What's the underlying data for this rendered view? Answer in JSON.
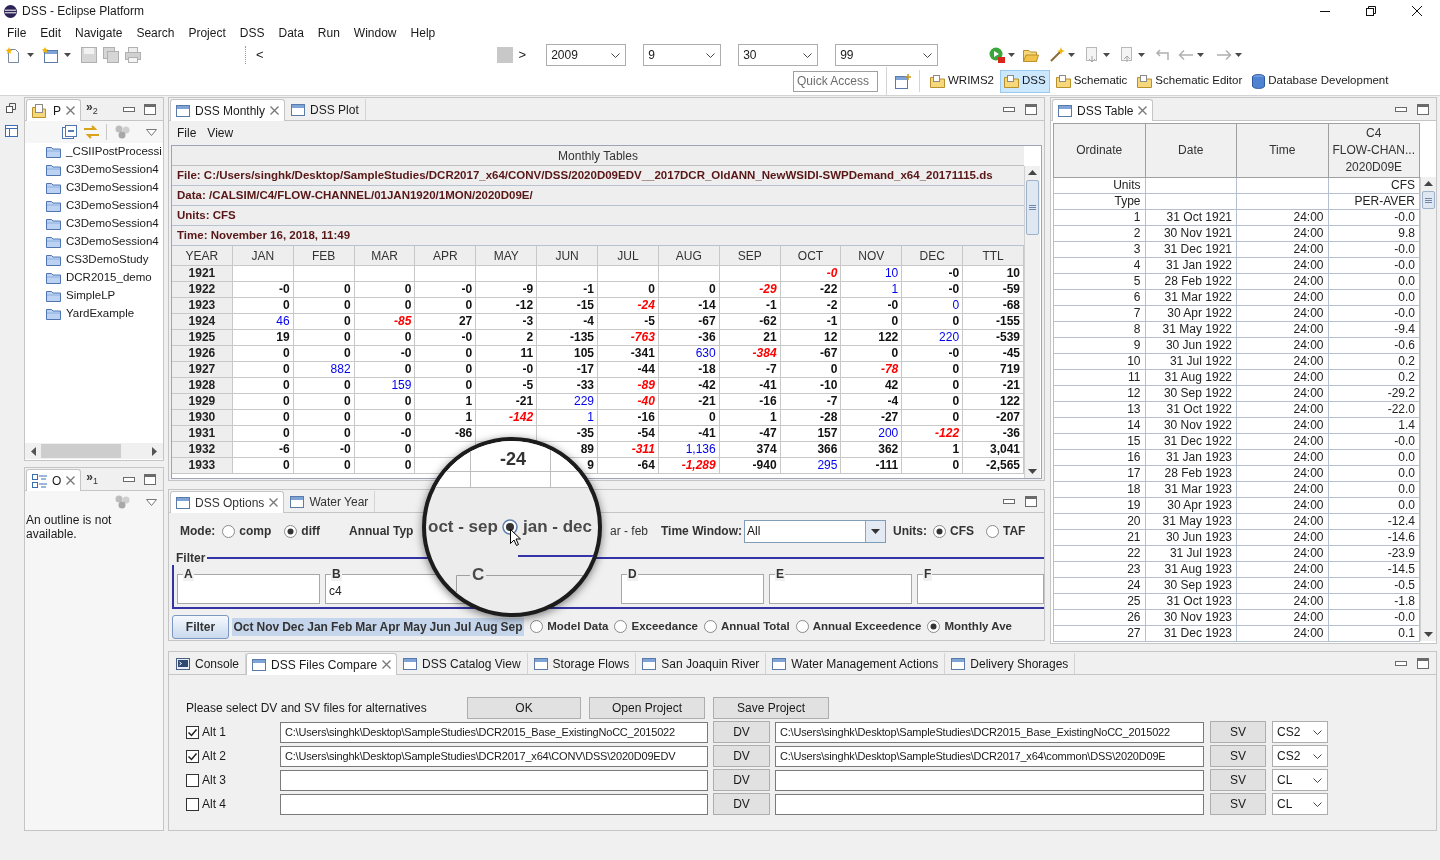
{
  "window": {
    "title": "DSS - Eclipse Platform"
  },
  "menu_bar": [
    "File",
    "Edit",
    "Navigate",
    "Search",
    "Project",
    "DSS",
    "Data",
    "Run",
    "Window",
    "Help"
  ],
  "toolbar": {
    "back": "<",
    "forward": ">",
    "combos": [
      "2009",
      "9",
      "30",
      "99"
    ]
  },
  "quick_access": {
    "placeholder": "Quick Access"
  },
  "perspectives": [
    {
      "label": "WRIMS2",
      "selected": false
    },
    {
      "label": "DSS",
      "selected": true
    },
    {
      "label": "Schematic",
      "selected": false
    },
    {
      "label": "Schematic Editor",
      "selected": false
    },
    {
      "label": "Database Development",
      "selected": false
    }
  ],
  "project_explorer": {
    "tabs": [
      {
        "label": "P",
        "selected": true
      }
    ],
    "overflow": {
      "symbol": "»",
      "count": "2"
    },
    "items": [
      "_CSIIPostProcessi",
      "C3DemoSession4",
      "C3DemoSession4",
      "C3DemoSession4",
      "C3DemoSession4",
      "C3DemoSession4",
      "CS3DemoStudy",
      "DCR2015_demo",
      "SimpleLP",
      "YardExample"
    ]
  },
  "outline": {
    "tabs": [
      {
        "label": "O",
        "selected": true
      }
    ],
    "overflow": {
      "symbol": "»",
      "count": "1"
    },
    "message": "An outline is not available."
  },
  "monthly_view": {
    "tabs": [
      {
        "label": "DSS Monthly",
        "selected": true
      },
      {
        "label": "DSS Plot",
        "selected": false
      }
    ],
    "menu": [
      "File",
      "View"
    ],
    "table": {
      "title": "Monthly Tables",
      "info": [
        "File: C:/Users/singhk/Desktop/SampleStudies/DCR2017_x64/CONV/DSS/2020D09EDV__2017DCR_OldANN_NewWSIDI-SWPDemand_x64_20171115.ds",
        "Data: /CALSIM/C4/FLOW-CHANNEL/01JAN1920/1MON/2020D09E/",
        "Units: CFS",
        "Time: November 16, 2018, 11:49"
      ],
      "columns": [
        "YEAR",
        "JAN",
        "FEB",
        "MAR",
        "APR",
        "MAY",
        "JUN",
        "JUL",
        "AUG",
        "SEP",
        "OCT",
        "NOV",
        "DEC",
        "TTL"
      ],
      "rows": [
        {
          "year": "1921",
          "cells": [
            null,
            null,
            null,
            null,
            null,
            null,
            null,
            null,
            null,
            {
              "text": "-0",
              "kind": "min"
            },
            {
              "text": "10",
              "kind": "max"
            },
            "-0",
            "10"
          ]
        },
        {
          "year": "1922",
          "cells": [
            "-0",
            "0",
            "0",
            "-0",
            "-9",
            "-1",
            "0",
            "0",
            {
              "text": "-29",
              "kind": "min"
            },
            "-22",
            {
              "text": "1",
              "kind": "max"
            },
            "-0",
            "-59"
          ]
        },
        {
          "year": "1923",
          "cells": [
            "0",
            "0",
            "0",
            "0",
            "-12",
            "-15",
            {
              "text": "-24",
              "kind": "min"
            },
            "-14",
            "-1",
            "-2",
            "-0",
            {
              "text": "0",
              "kind": "max"
            },
            "-68"
          ]
        },
        {
          "year": "1924",
          "cells": [
            {
              "text": "46",
              "kind": "max"
            },
            "0",
            {
              "text": "-85",
              "kind": "min"
            },
            "27",
            "-3",
            "-4",
            "-5",
            "-67",
            "-62",
            "-1",
            "0",
            "0",
            "-155"
          ]
        },
        {
          "year": "1925",
          "cells": [
            "19",
            "0",
            "0",
            "-0",
            "2",
            "-135",
            {
              "text": "-763",
              "kind": "min"
            },
            "-36",
            "21",
            "12",
            "122",
            {
              "text": "220",
              "kind": "max"
            },
            "-539"
          ]
        },
        {
          "year": "1926",
          "cells": [
            "0",
            "0",
            "-0",
            "0",
            "11",
            "105",
            "-341",
            {
              "text": "630",
              "kind": "max"
            },
            {
              "text": "-384",
              "kind": "min"
            },
            "-67",
            "0",
            "-0",
            "-45"
          ]
        },
        {
          "year": "1927",
          "cells": [
            "0",
            {
              "text": "882",
              "kind": "max"
            },
            "0",
            "0",
            "-0",
            "-17",
            "-44",
            "-18",
            "-7",
            "0",
            {
              "text": "-78",
              "kind": "min"
            },
            "0",
            "719"
          ]
        },
        {
          "year": "1928",
          "cells": [
            "0",
            "0",
            {
              "text": "159",
              "kind": "max"
            },
            "0",
            "-5",
            "-33",
            {
              "text": "-89",
              "kind": "min"
            },
            "-42",
            "-41",
            "-10",
            "42",
            "0",
            "-21"
          ]
        },
        {
          "year": "1929",
          "cells": [
            "0",
            "0",
            "0",
            "1",
            "-21",
            {
              "text": "229",
              "kind": "max"
            },
            {
              "text": "-40",
              "kind": "min"
            },
            "-21",
            "-16",
            "-7",
            "-4",
            "0",
            "122"
          ]
        },
        {
          "year": "1930",
          "cells": [
            "0",
            "0",
            "0",
            "1",
            {
              "text": "-142",
              "kind": "min"
            },
            {
              "text": "1",
              "kind": "max"
            },
            "-16",
            "0",
            "1",
            "-28",
            "-27",
            "0",
            "-207"
          ]
        },
        {
          "year": "1931",
          "cells": [
            "0",
            "0",
            "-0",
            "-86",
            null,
            "-35",
            "-54",
            "-41",
            "-47",
            "157",
            {
              "text": "200",
              "kind": "max"
            },
            {
              "text": "-122",
              "kind": "min"
            },
            "-36"
          ]
        },
        {
          "year": "1932",
          "cells": [
            "-6",
            "-0",
            "0",
            null,
            null,
            "89",
            {
              "text": "-311",
              "kind": "min"
            },
            {
              "text": "1,136",
              "kind": "max"
            },
            "374",
            "366",
            "362",
            "1",
            "3,041"
          ]
        },
        {
          "year": "1933",
          "cells": [
            "0",
            "0",
            "0",
            null,
            null,
            "9",
            "-64",
            {
              "text": "-1,289",
              "kind": "min"
            },
            "-940",
            {
              "text": "295",
              "kind": "max"
            },
            "-111",
            "0",
            "-2,565"
          ]
        }
      ]
    }
  },
  "options_view": {
    "tabs": [
      {
        "label": "DSS Options",
        "selected": true
      },
      {
        "label": "Water Year",
        "selected": false
      }
    ],
    "mode": {
      "label": "Mode:",
      "options": [
        {
          "label": "comp",
          "selected": false
        },
        {
          "label": "diff",
          "selected": true
        }
      ]
    },
    "annual_type": {
      "label": "Annual Typ",
      "option_fragment": "ar - feb"
    },
    "time_window": {
      "label": "Time Window:",
      "value": "All"
    },
    "units": {
      "label": "Units:",
      "options": [
        {
          "label": "CFS",
          "selected": true
        },
        {
          "label": "TAF",
          "selected": false
        }
      ]
    },
    "filter": {
      "title": "Filter",
      "fields": [
        {
          "label": "A"
        },
        {
          "label": "B",
          "value": "c4"
        },
        {
          "label": "D"
        },
        {
          "label": "E"
        },
        {
          "label": "F"
        }
      ]
    },
    "filter_button": "Filter",
    "months": [
      {
        "label": "Oct",
        "selected": true
      },
      {
        "label": "Nov",
        "selected": true
      },
      {
        "label": "Dec",
        "selected": true
      },
      {
        "label": "Jan",
        "selected": true
      },
      {
        "label": "Feb",
        "selected": true
      },
      {
        "label": "Mar",
        "selected": true
      },
      {
        "label": "Apr",
        "selected": true
      },
      {
        "label": "May",
        "selected": true
      },
      {
        "label": "Jun",
        "selected": true
      },
      {
        "label": "Jul",
        "selected": true
      },
      {
        "label": "Aug",
        "selected": true
      },
      {
        "label": "Sep",
        "selected": true
      }
    ],
    "views": [
      {
        "label": "Model Data",
        "selected": false
      },
      {
        "label": "Exceedance",
        "selected": false
      },
      {
        "label": "Annual Total",
        "selected": false
      },
      {
        "label": "Annual Exceedence",
        "selected": false
      },
      {
        "label": "Monthly Ave",
        "selected": true
      }
    ]
  },
  "magnifier": {
    "cell": "-24",
    "fragment": "oct - sep",
    "option": {
      "label": "jan - dec",
      "selected": true
    },
    "field_label": "C"
  },
  "dss_table_view": {
    "tabs": [
      {
        "label": "DSS Table",
        "selected": true
      }
    ],
    "columns": [
      "Ordinate",
      "Date",
      "Time",
      "C4\nFLOW-CHAN...\n2020D09E"
    ],
    "meta": [
      {
        "label": "Units",
        "value": "CFS"
      },
      {
        "label": "Type",
        "value": "PER-AVER"
      }
    ],
    "rows": [
      [
        "1",
        "31 Oct 1921",
        "24:00",
        "-0.0"
      ],
      [
        "2",
        "30 Nov 1921",
        "24:00",
        "9.8"
      ],
      [
        "3",
        "31 Dec 1921",
        "24:00",
        "-0.0"
      ],
      [
        "4",
        "31 Jan 1922",
        "24:00",
        "-0.0"
      ],
      [
        "5",
        "28 Feb 1922",
        "24:00",
        "0.0"
      ],
      [
        "6",
        "31 Mar 1922",
        "24:00",
        "0.0"
      ],
      [
        "7",
        "30 Apr 1922",
        "24:00",
        "-0.0"
      ],
      [
        "8",
        "31 May 1922",
        "24:00",
        "-9.4"
      ],
      [
        "9",
        "30 Jun 1922",
        "24:00",
        "-0.6"
      ],
      [
        "10",
        "31 Jul 1922",
        "24:00",
        "0.2"
      ],
      [
        "11",
        "31 Aug 1922",
        "24:00",
        "0.2"
      ],
      [
        "12",
        "30 Sep 1922",
        "24:00",
        "-29.2"
      ],
      [
        "13",
        "31 Oct 1922",
        "24:00",
        "-22.0"
      ],
      [
        "14",
        "30 Nov 1922",
        "24:00",
        "1.4"
      ],
      [
        "15",
        "31 Dec 1922",
        "24:00",
        "-0.0"
      ],
      [
        "16",
        "31 Jan 1923",
        "24:00",
        "0.0"
      ],
      [
        "17",
        "28 Feb 1923",
        "24:00",
        "0.0"
      ],
      [
        "18",
        "31 Mar 1923",
        "24:00",
        "0.0"
      ],
      [
        "19",
        "30 Apr 1923",
        "24:00",
        "0.0"
      ],
      [
        "20",
        "31 May 1923",
        "24:00",
        "-12.4"
      ],
      [
        "21",
        "30 Jun 1923",
        "24:00",
        "-14.6"
      ],
      [
        "22",
        "31 Jul 1923",
        "24:00",
        "-23.9"
      ],
      [
        "23",
        "31 Aug 1923",
        "24:00",
        "-14.5"
      ],
      [
        "24",
        "30 Sep 1923",
        "24:00",
        "-0.5"
      ],
      [
        "25",
        "31 Oct 1923",
        "24:00",
        "-1.8"
      ],
      [
        "26",
        "30 Nov 1923",
        "24:00",
        "-0.0"
      ],
      [
        "27",
        "31 Dec 1923",
        "24:00",
        "0.1"
      ]
    ]
  },
  "bottom_view": {
    "tabs": [
      {
        "label": "Console",
        "selected": false
      },
      {
        "label": "DSS Files Compare",
        "selected": true
      },
      {
        "label": "DSS Catalog View",
        "selected": false
      },
      {
        "label": "Storage Flows",
        "selected": false
      },
      {
        "label": "San Joaquin River",
        "selected": false
      },
      {
        "label": "Water Management Actions",
        "selected": false
      },
      {
        "label": "Delivery Shorages",
        "selected": false
      }
    ],
    "prompt": "Please select DV and SV files for alternatives",
    "buttons": [
      "OK",
      "Open Project",
      "Save Project"
    ],
    "alternatives": [
      {
        "label": "Alt 1",
        "checked": true,
        "dv_path": "C:\\Users\\singhk\\Desktop\\SampleStudies\\DCR2015_Base_ExistingNoCC_2015022",
        "dv_button": "DV",
        "sv_path": "C:\\Users\\singhk\\Desktop\\SampleStudies\\DCR2015_Base_ExistingNoCC_2015022",
        "sv_button": "SV",
        "type": "CS2"
      },
      {
        "label": "Alt 2",
        "checked": true,
        "dv_path": "C:\\Users\\singhk\\Desktop\\SampleStudies\\DCR2017_x64\\CONV\\DSS\\2020D09EDV",
        "dv_button": "DV",
        "sv_path": "C:\\Users\\singhk\\Desktop\\SampleStudies\\DCR2017_x64\\common\\DSS\\2020D09E",
        "sv_button": "SV",
        "type": "CS2"
      },
      {
        "label": "Alt 3",
        "checked": false,
        "dv_button": "DV",
        "sv_button": "SV",
        "type": "CL"
      },
      {
        "label": "Alt 4",
        "checked": false,
        "dv_button": "DV",
        "sv_button": "SV",
        "type": "CL"
      }
    ]
  }
}
